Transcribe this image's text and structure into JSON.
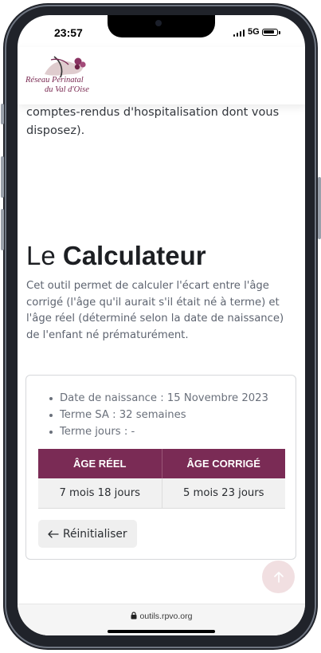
{
  "status_bar": {
    "time": "23:57",
    "network": "5G"
  },
  "header": {
    "logo_name": "Réseau Périnatal",
    "logo_region": "du Val d'Oise"
  },
  "intro": {
    "text_tail": "comptes-rendus d'hospitalisation dont vous disposez)."
  },
  "calculator": {
    "title_light": "Le ",
    "title_bold": "Calculateur",
    "description": "Cet outil permet de calculer l'écart entre l'âge corrigé (l'âge qu'il aurait s'il était né à terme) et l'âge réel (déterminé selon la date de naissance) de l'enfant né prématurément.",
    "info": [
      "Date de naissance : 15 Novembre 2023",
      "Terme SA : 32 semaines",
      "Terme jours : -"
    ],
    "table": {
      "headers": [
        "ÂGE RÉEL",
        "ÂGE CORRIGÉ"
      ],
      "row": [
        "7 mois 18 jours",
        "5 mois 23 jours"
      ]
    },
    "reset_label": "Réinitialiser"
  },
  "back_to_top": {
    "icon": "arrow-up-icon"
  },
  "browser": {
    "url": "outils.rpvo.org"
  },
  "colors": {
    "brand": "#7a2b55",
    "back_to_top_bg": "#f1dfe1"
  }
}
